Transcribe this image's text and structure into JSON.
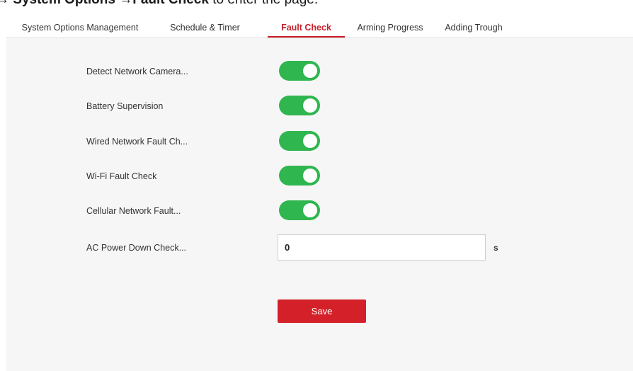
{
  "doc_caption": {
    "prefix": "→",
    "menu": "System Options",
    "arrow": "→",
    "submenu": "Fault Check",
    "suffix": "to enter the page."
  },
  "tabs": [
    {
      "label": "System Options Management",
      "active": false
    },
    {
      "label": "Schedule & Timer",
      "active": false
    },
    {
      "label": "Fault Check",
      "active": true
    },
    {
      "label": "Arming Progress",
      "active": false
    },
    {
      "label": "Adding Trough",
      "active": false
    }
  ],
  "settings": [
    {
      "label": "Detect Network Camera...",
      "enabled": true
    },
    {
      "label": "Battery Supervision",
      "enabled": true
    },
    {
      "label": "Wired Network Fault Ch...",
      "enabled": true
    },
    {
      "label": "Wi-Fi Fault Check",
      "enabled": true
    },
    {
      "label": "Cellular Network Fault...",
      "enabled": true
    }
  ],
  "ac_power": {
    "label": "AC Power Down Check...",
    "value": "0",
    "unit": "s"
  },
  "save_label": "Save",
  "colors": {
    "accent": "#c8202a",
    "toggle_on": "#2fb64f",
    "save_button": "#d42129",
    "page_bg": "#f6f6f6"
  }
}
